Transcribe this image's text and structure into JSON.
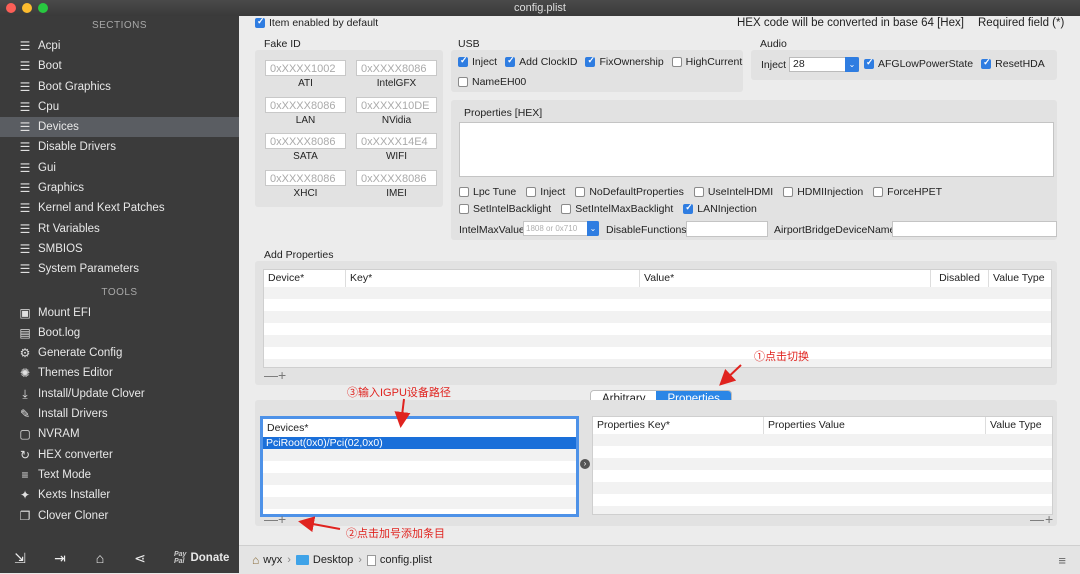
{
  "window_title": "config.plist",
  "colors": {
    "accent": "#2f7de1",
    "annotation": "#e0231f",
    "sidebar_bg": "#3b3b3b"
  },
  "sidebar": {
    "sections_label": "SECTIONS",
    "sections": [
      {
        "label": "Acpi",
        "icon": "list-icon"
      },
      {
        "label": "Boot",
        "icon": "list-icon"
      },
      {
        "label": "Boot Graphics",
        "icon": "list-icon"
      },
      {
        "label": "Cpu",
        "icon": "list-icon"
      },
      {
        "label": "Devices",
        "icon": "list-icon",
        "selected": true
      },
      {
        "label": "Disable Drivers",
        "icon": "list-icon"
      },
      {
        "label": "Gui",
        "icon": "list-icon"
      },
      {
        "label": "Graphics",
        "icon": "list-icon"
      },
      {
        "label": "Kernel and Kext Patches",
        "icon": "list-icon"
      },
      {
        "label": "Rt Variables",
        "icon": "list-icon"
      },
      {
        "label": "SMBIOS",
        "icon": "list-icon"
      },
      {
        "label": "System Parameters",
        "icon": "list-icon"
      }
    ],
    "tools_label": "TOOLS",
    "tools": [
      {
        "label": "Mount EFI",
        "icon": "disk-icon"
      },
      {
        "label": "Boot.log",
        "icon": "document-icon"
      },
      {
        "label": "Generate Config",
        "icon": "gears-icon"
      },
      {
        "label": "Themes Editor",
        "icon": "palette-icon"
      },
      {
        "label": "Install/Update Clover",
        "icon": "download-icon"
      },
      {
        "label": "Install Drivers",
        "icon": "wrench-icon"
      },
      {
        "label": "NVRAM",
        "icon": "chip-icon"
      },
      {
        "label": "HEX converter",
        "icon": "refresh-icon"
      },
      {
        "label": "Text Mode",
        "icon": "text-lines-icon"
      },
      {
        "label": "Kexts Installer",
        "icon": "puzzle-icon"
      },
      {
        "label": "Clover Cloner",
        "icon": "copy-icon"
      }
    ],
    "donate_label": "Donate",
    "paypal_text_1": "Pay",
    "paypal_text_2": "Pal"
  },
  "top": {
    "item_enabled": "Item enabled by default",
    "hex_note": "HEX code will be converted in base 64 [Hex]",
    "required": "Required field (*)"
  },
  "fake_id": {
    "title": "Fake ID",
    "fields": [
      {
        "placeholder": "0xXXXX1002",
        "label": "ATI"
      },
      {
        "placeholder": "0xXXXX8086",
        "label": "IntelGFX"
      },
      {
        "placeholder": "0xXXXX8086",
        "label": "LAN"
      },
      {
        "placeholder": "0xXXXX10DE",
        "label": "NVidia"
      },
      {
        "placeholder": "0xXXXX8086",
        "label": "SATA"
      },
      {
        "placeholder": "0xXXXX14E4",
        "label": "WIFI"
      },
      {
        "placeholder": "0xXXXX8086",
        "label": "XHCI"
      },
      {
        "placeholder": "0xXXXX8086",
        "label": "IMEI"
      }
    ]
  },
  "usb": {
    "title": "USB",
    "items": [
      {
        "label": "Inject",
        "checked": true
      },
      {
        "label": "Add ClockID",
        "checked": true
      },
      {
        "label": "FixOwnership",
        "checked": true
      },
      {
        "label": "HighCurrent",
        "checked": false
      },
      {
        "label": "NameEH00",
        "checked": false
      }
    ]
  },
  "audio": {
    "title": "Audio",
    "inject_label": "Inject",
    "inject_value": "28",
    "items": [
      {
        "label": "AFGLowPowerState",
        "checked": true
      },
      {
        "label": "ResetHDA",
        "checked": true
      }
    ]
  },
  "properties_hex": {
    "title": "Properties [HEX]",
    "checks_row1": [
      {
        "label": "Lpc Tune",
        "checked": false
      },
      {
        "label": "Inject",
        "checked": false
      },
      {
        "label": "NoDefaultProperties",
        "checked": false
      },
      {
        "label": "UseIntelHDMI",
        "checked": false
      },
      {
        "label": "HDMIInjection",
        "checked": false
      },
      {
        "label": "ForceHPET",
        "checked": false
      }
    ],
    "checks_row2": [
      {
        "label": "SetIntelBacklight",
        "checked": false
      },
      {
        "label": "SetIntelMaxBacklight",
        "checked": false
      },
      {
        "label": "LANInjection",
        "checked": true
      }
    ],
    "intel_max_label": "IntelMaxValue",
    "intel_max_placeholder": "1808 or 0x710",
    "disable_functions_label": "DisableFunctions",
    "airport_label": "AirportBridgeDeviceName"
  },
  "add_properties": {
    "title": "Add Properties",
    "columns": [
      "Device*",
      "Key*",
      "Value*",
      "Disabled",
      "Value Type"
    ]
  },
  "tabs": {
    "arbitrary": "Arbitrary",
    "properties": "Properties"
  },
  "devices_table": {
    "column": "Devices*",
    "rows": [
      "PciRoot(0x0)/Pci(02,0x0)"
    ]
  },
  "props_table": {
    "columns": [
      "Properties Key*",
      "Properties Value",
      "Value Type"
    ]
  },
  "plus_minus": {
    "minus": "—",
    "plus": "+"
  },
  "annotations": {
    "click_switch": "①点击切换",
    "input_path": "③输入IGPU设备路径",
    "click_plus": "②点击加号添加条目"
  },
  "breadcrumb": {
    "user": "wyx",
    "folder": "Desktop",
    "file": "config.plist",
    "sep": "›"
  }
}
